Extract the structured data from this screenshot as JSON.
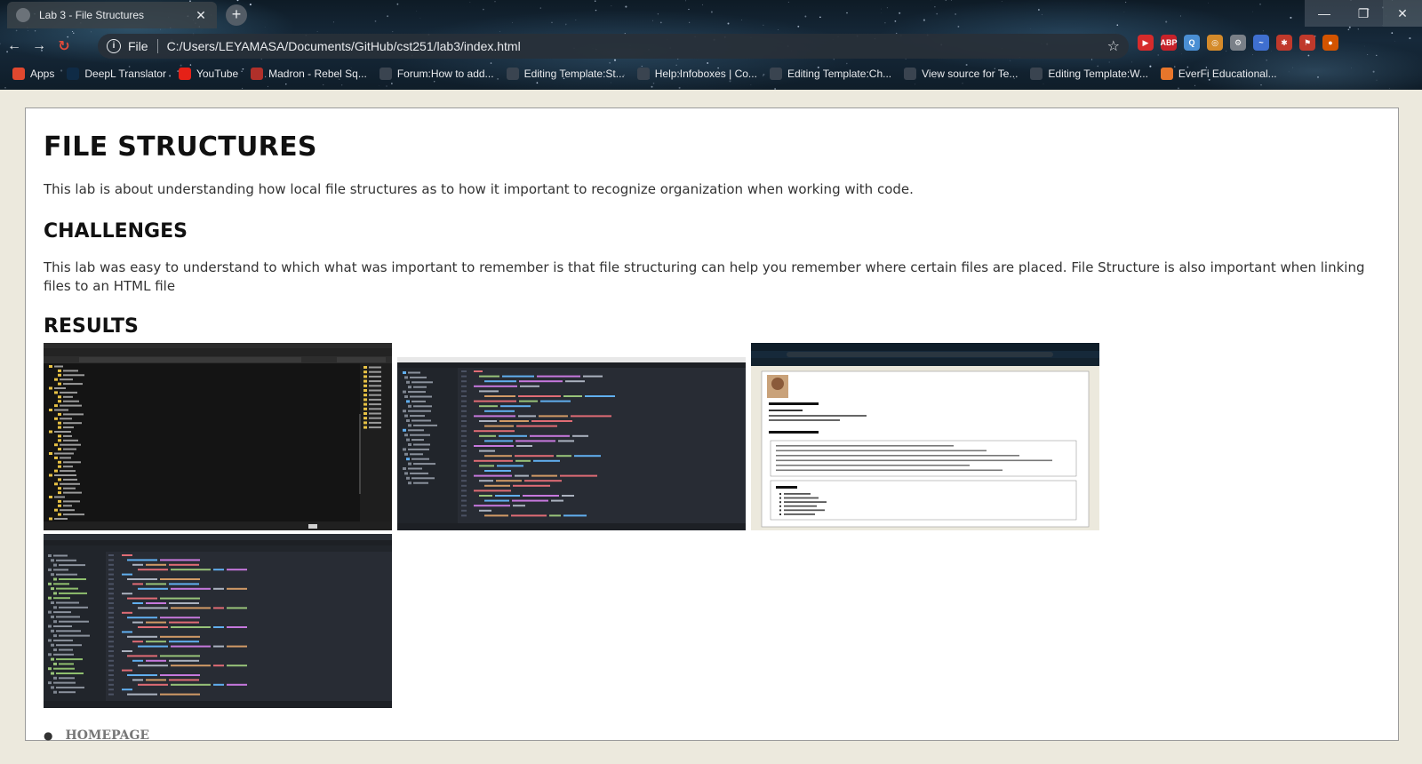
{
  "browser": {
    "tab_title": "Lab 3 - File Structures",
    "new_tab_label": "+",
    "omnibox": {
      "scheme": "File",
      "url": "C:/Users/LEYAMASA/Documents/GitHub/cst251/lab3/index.html"
    },
    "extensions": [
      {
        "name": "youtube-ext-icon",
        "label": "▶",
        "color": "#d62b2b"
      },
      {
        "name": "adblock-plus-icon",
        "label": "ABP",
        "color": "#c7222a"
      },
      {
        "name": "search-ext-icon",
        "label": "Q",
        "color": "#4a8fd4"
      },
      {
        "name": "owl-ext-icon",
        "label": "◎",
        "color": "#d48a2a"
      },
      {
        "name": "gear-ext-icon",
        "label": "⚙",
        "color": "#7a8088"
      },
      {
        "name": "wave-ext-icon",
        "label": "~",
        "color": "#3f6fd0"
      },
      {
        "name": "puzzle-ext-icon",
        "label": "✱",
        "color": "#c0392b"
      },
      {
        "name": "flag-ext-icon",
        "label": "⚑",
        "color": "#c0392b"
      },
      {
        "name": "profile-avatar-icon",
        "label": "●",
        "color": "#d35400"
      }
    ],
    "bookmarks": [
      {
        "label": "Apps",
        "icon": "apps-grid-icon",
        "color": "#e0482f"
      },
      {
        "label": "DeepL Translator",
        "icon": "deepl-icon",
        "color": "#0f2b46"
      },
      {
        "label": "YouTube",
        "icon": "youtube-icon",
        "color": "#e62117"
      },
      {
        "label": "Madron - Rebel Sq...",
        "icon": "madron-icon",
        "color": "#b0302a"
      },
      {
        "label": "Forum:How to add...",
        "icon": "heart-icon",
        "color": "#3a4450"
      },
      {
        "label": "Editing Template:St...",
        "icon": "fandom-icon",
        "color": "#3a4450"
      },
      {
        "label": "Help:Infoboxes | Co...",
        "icon": "fandom-icon",
        "color": "#3a4450"
      },
      {
        "label": "Editing Template:Ch...",
        "icon": "plus-icon",
        "color": "#3a4450"
      },
      {
        "label": "View source for Te...",
        "icon": "fandom-icon",
        "color": "#3a4450"
      },
      {
        "label": "Editing Template:W...",
        "icon": "heart-icon",
        "color": "#3a4450"
      },
      {
        "label": "EverFi Educational...",
        "icon": "everfi-icon",
        "color": "#e8762b"
      }
    ]
  },
  "page": {
    "title": "FILE STRUCTURES",
    "intro": "This lab is about understanding how local file structures as to how it important to recognize organization when working with code.",
    "challenges_heading": "CHALLENGES",
    "challenges_text": "This lab was easy to understand to which what was important to remember is that file structuring can help you remember where certain files are placed. File Structure is also important when linking files to an HTML file",
    "results_heading": "RESULTS",
    "screenshots": [
      {
        "kind": "explorer"
      },
      {
        "kind": "editor"
      },
      {
        "kind": "webpage"
      },
      {
        "kind": "editor2"
      }
    ],
    "home_link": "HOMEPAGE"
  }
}
